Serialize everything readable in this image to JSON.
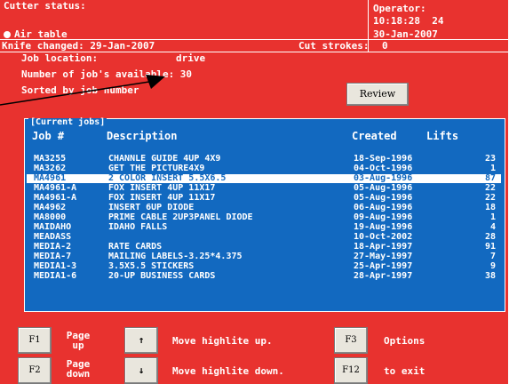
{
  "header": {
    "cutter_status": "Cutter status:",
    "air_table": "Air table",
    "operator_label": "Operator:",
    "operator_time": "10:18:28  24",
    "operator_date": "30-Jan-2007",
    "knife_changed": "Knife changed: 29-Jan-2007",
    "cut_strokes_label": "Cut strokes:",
    "cut_strokes_value": "0"
  },
  "info": {
    "job_location": "Job location: ",
    "job_location_value": "drive",
    "jobs_available": "Number of job's available: 30",
    "sorted_by": "Sorted by job number",
    "review_label": "Review"
  },
  "jobs": {
    "title": "[Current jobs]",
    "columns": [
      "Job #",
      "Description",
      "Created",
      "Lifts"
    ],
    "rows": [
      {
        "job": "MA3255",
        "desc": "CHANNLE GUIDE 4UP 4X9",
        "created": "18-Sep-1996",
        "lifts": "23"
      },
      {
        "job": "MA3262",
        "desc": "GET THE PICTURE4X9",
        "created": "04-Oct-1996",
        "lifts": "1"
      },
      {
        "job": "MA4961",
        "desc": "2 COLOR INSERT 5.5X6.5",
        "created": "03-Aug-1996",
        "lifts": "87"
      },
      {
        "job": "MA4961-A",
        "desc": "FOX INSERT 4UP 11X17",
        "created": "05-Aug-1996",
        "lifts": "22"
      },
      {
        "job": "MA4961-A",
        "desc": "FOX INSERT 4UP 11X17",
        "created": "05-Aug-1996",
        "lifts": "22"
      },
      {
        "job": "MA4962",
        "desc": "INSERT 6UP DIODE",
        "created": "06-Aug-1996",
        "lifts": "18"
      },
      {
        "job": "MA8000",
        "desc": "PRIME CABLE 2UP3PANEL DIODE",
        "created": "09-Aug-1996",
        "lifts": "1"
      },
      {
        "job": "MAIDAHO",
        "desc": "IDAHO FALLS",
        "created": "19-Aug-1996",
        "lifts": "4"
      },
      {
        "job": "MEADASS",
        "desc": "",
        "created": "10-Oct-2002",
        "lifts": "28"
      },
      {
        "job": "MEDIA-2",
        "desc": "RATE CARDS",
        "created": "18-Apr-1997",
        "lifts": "91"
      },
      {
        "job": "MEDIA-7",
        "desc": "MAILING LABELS-3.25*4.375",
        "created": "27-May-1997",
        "lifts": "7"
      },
      {
        "job": "MEDIA1-3",
        "desc": "3.5X5.5 STICKERS",
        "created": "25-Apr-1997",
        "lifts": "9"
      },
      {
        "job": "MEDIA1-6",
        "desc": "20-UP BUSINESS CARDS",
        "created": "28-Apr-1997",
        "lifts": "38"
      }
    ],
    "selected_index": 2
  },
  "keys": {
    "f1": "F1",
    "f1_label": "Page up",
    "f2": "F2",
    "f2_label": "Page down",
    "up_arrow": "↑",
    "up_label": "Move highlite up.",
    "down_arrow": "↓",
    "down_label": "Move highlite down.",
    "f3": "F3",
    "f3_label": "Options",
    "f12": "F12",
    "f12_label": "to exit"
  },
  "colors": {
    "screen_bg": "#e8322f",
    "panel_bg": "#1269c0",
    "text": "#ffffff",
    "key_bg": "#e9e6dd"
  }
}
